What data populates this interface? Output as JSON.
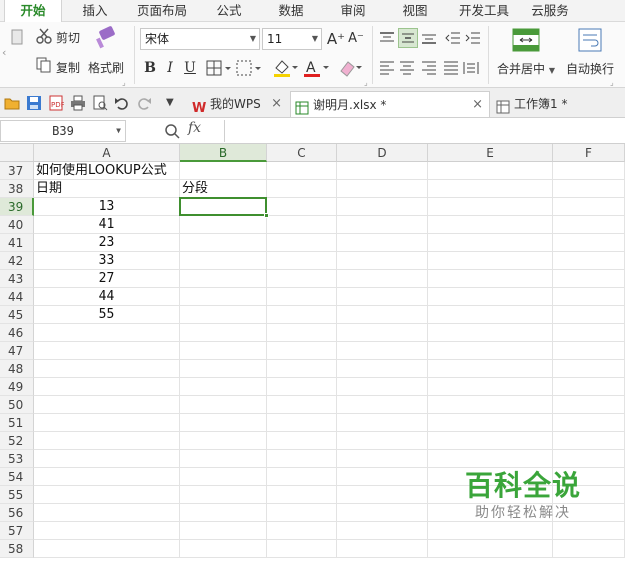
{
  "menu": {
    "tabs": [
      "开始",
      "插入",
      "页面布局",
      "公式",
      "数据",
      "审阅",
      "视图",
      "开发工具",
      "云服务"
    ],
    "active": "开始"
  },
  "ribbon": {
    "cut_label": "剪切",
    "copy_label": "复制",
    "format_painter_label": "格式刷",
    "font_name": "宋体",
    "font_size": "11",
    "merge_center_label": "合并居中",
    "wrap_text_label": "自动换行",
    "bold": "B",
    "italic": "I",
    "underline": "U",
    "font_color_glyph": "A",
    "grow_font_glyph": "A⁺",
    "shrink_font_glyph": "A⁻"
  },
  "doc_tabs": [
    {
      "label": "我的WPS",
      "active": false
    },
    {
      "label": "谢明月.xlsx *",
      "active": true
    },
    {
      "label": "工作簿1 *",
      "active": false
    }
  ],
  "formula_bar": {
    "name_box": "B39",
    "fx_label": "fx",
    "formula": ""
  },
  "sheet": {
    "columns": [
      "A",
      "B",
      "C",
      "D",
      "E",
      "F"
    ],
    "selected_column": "B",
    "selected_row": "39",
    "rows": [
      {
        "num": "37",
        "A": "如何使用LOOKUP公式",
        "B": ""
      },
      {
        "num": "38",
        "A": "日期",
        "B": "分段"
      },
      {
        "num": "39",
        "A": "13",
        "B": ""
      },
      {
        "num": "40",
        "A": "41",
        "B": ""
      },
      {
        "num": "41",
        "A": "23",
        "B": ""
      },
      {
        "num": "42",
        "A": "33",
        "B": ""
      },
      {
        "num": "43",
        "A": "27",
        "B": ""
      },
      {
        "num": "44",
        "A": "44",
        "B": ""
      },
      {
        "num": "45",
        "A": "55",
        "B": ""
      },
      {
        "num": "46",
        "A": "",
        "B": ""
      },
      {
        "num": "47",
        "A": "",
        "B": ""
      },
      {
        "num": "48",
        "A": "",
        "B": ""
      },
      {
        "num": "49",
        "A": "",
        "B": ""
      },
      {
        "num": "50",
        "A": "",
        "B": ""
      },
      {
        "num": "51",
        "A": "",
        "B": ""
      },
      {
        "num": "52",
        "A": "",
        "B": ""
      },
      {
        "num": "53",
        "A": "",
        "B": ""
      },
      {
        "num": "54",
        "A": "",
        "B": ""
      },
      {
        "num": "55",
        "A": "",
        "B": ""
      },
      {
        "num": "56",
        "A": "",
        "B": ""
      },
      {
        "num": "57",
        "A": "",
        "B": ""
      },
      {
        "num": "58",
        "A": "",
        "B": ""
      }
    ]
  },
  "watermark": {
    "title": "百科全说",
    "subtitle": "助你轻松解决"
  },
  "colors": {
    "accent": "#2a8a2a",
    "selection": "#3f8f2f"
  }
}
